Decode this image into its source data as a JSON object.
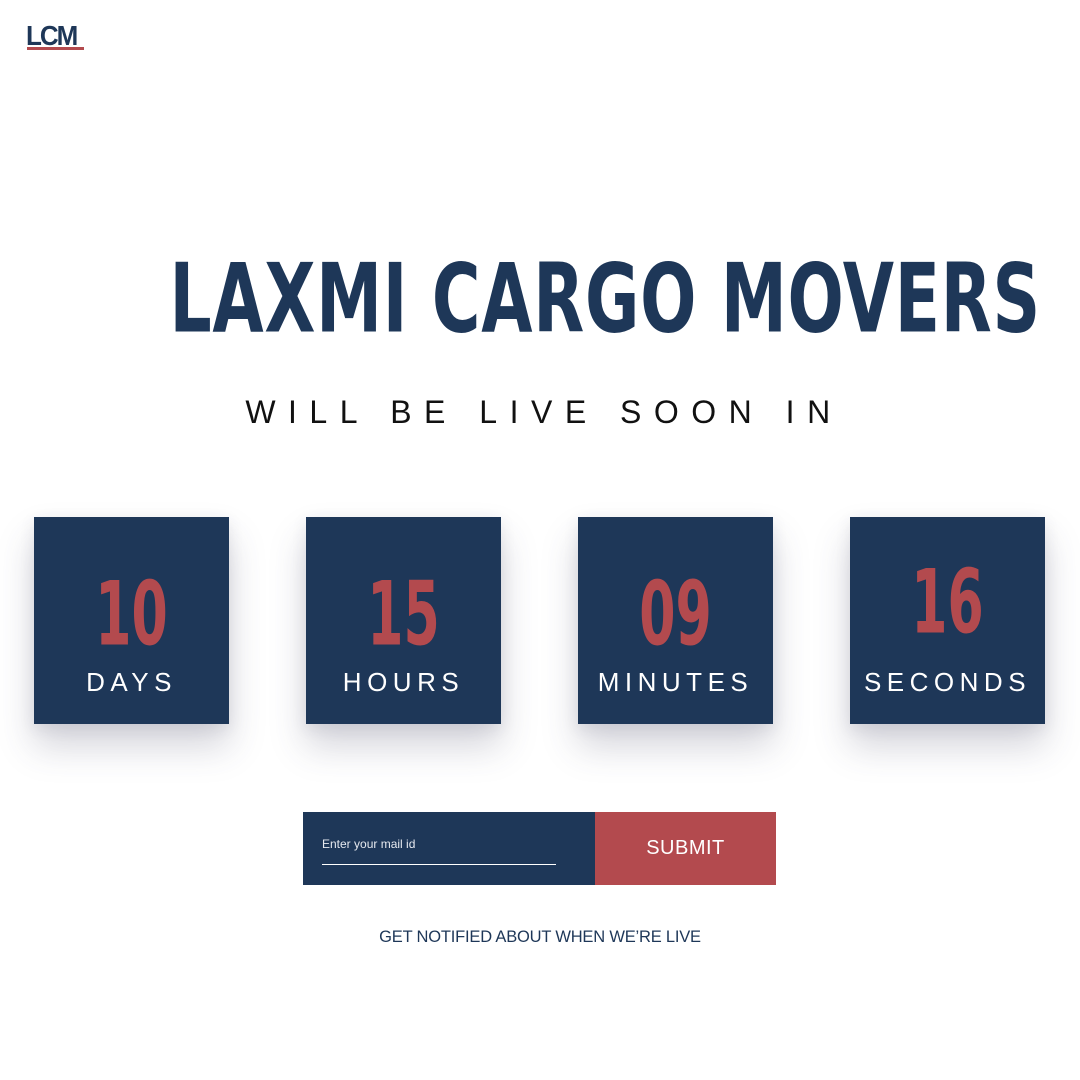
{
  "brand": {
    "logo_text": "LCM",
    "primary_color": "#1e3758",
    "accent_color": "#b34a4e"
  },
  "hero": {
    "title": "LAXMI CARGO MOVERS",
    "subtitle": "WILL BE LIVE SOON IN"
  },
  "countdown": {
    "days": {
      "value": "10",
      "label": "DAYS"
    },
    "hours": {
      "value": "15",
      "label": "HOURS"
    },
    "minutes": {
      "value": "09",
      "label": "MINUTES"
    },
    "seconds": {
      "value": "16",
      "label": "SECONDS"
    }
  },
  "subscribe": {
    "email_placeholder": "Enter your mail id",
    "email_value": "",
    "submit_label": "SUBMIT",
    "note": "GET NOTIFIED ABOUT WHEN WE’RE LIVE"
  }
}
